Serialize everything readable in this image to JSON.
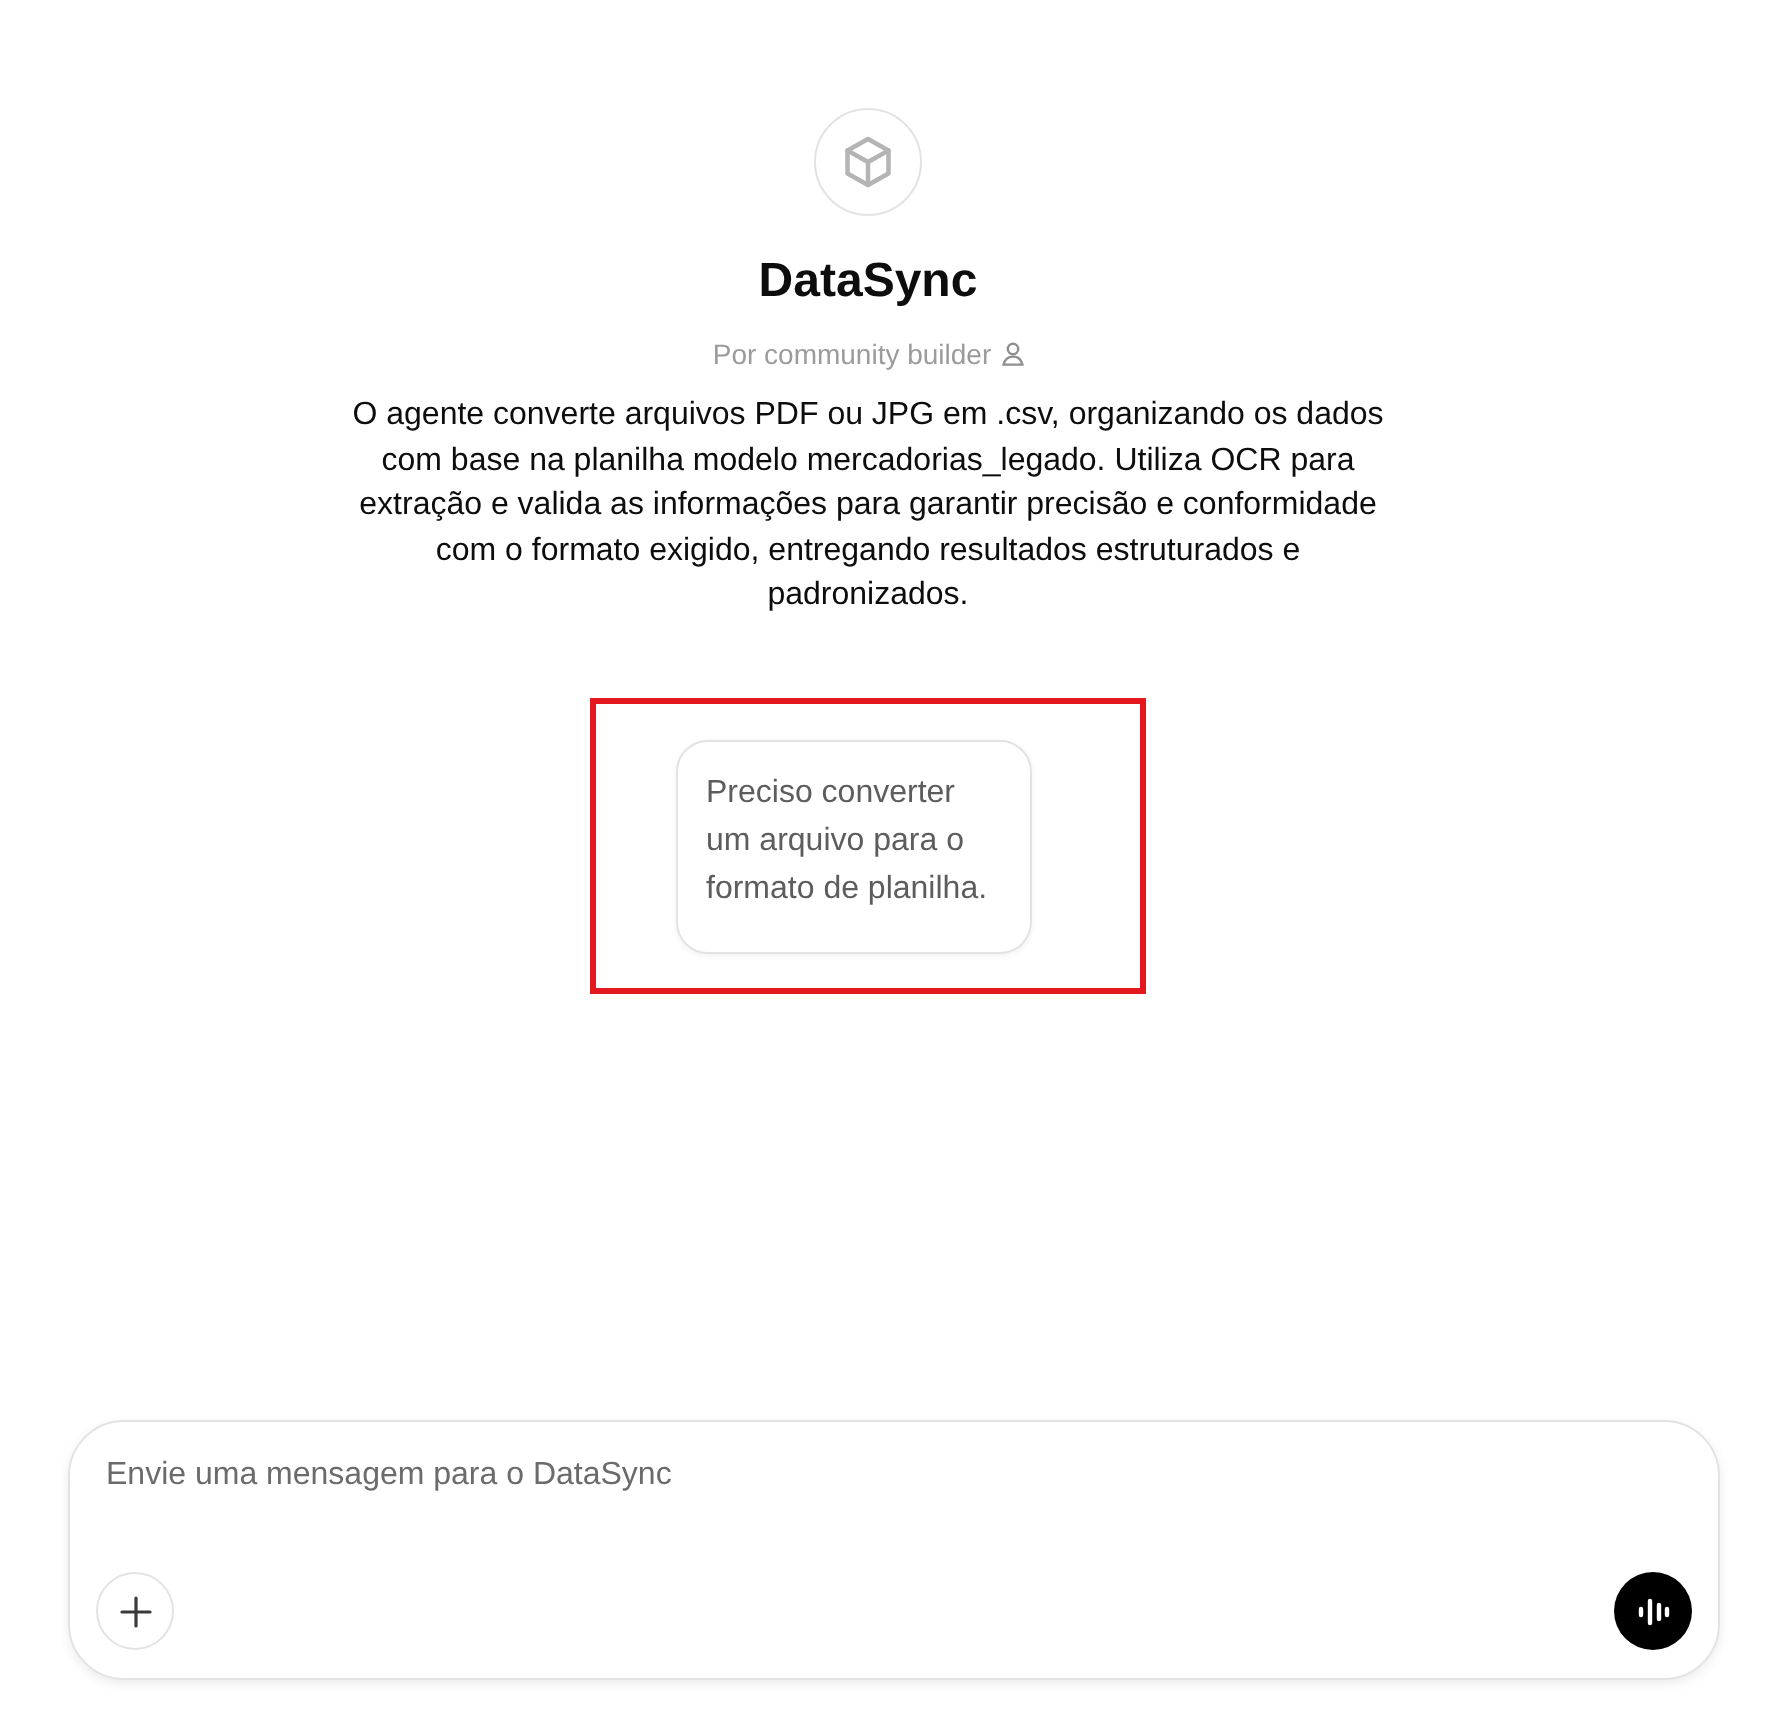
{
  "assistant": {
    "name": "DataSync",
    "byline": "Por community builder",
    "description": "O agente converte arquivos PDF ou JPG em .csv, organizando os dados com base na planilha modelo mercadorias_legado. Utiliza OCR para extração e valida as informações para garantir precisão e conformidade com o formato exigido, entregando resultados estruturados e padronizados."
  },
  "suggestions": [
    {
      "text": "Preciso converter um arquivo para o formato de planilha.",
      "highlighted": true
    }
  ],
  "composer": {
    "placeholder": "Envie uma mensagem para o DataSync"
  }
}
